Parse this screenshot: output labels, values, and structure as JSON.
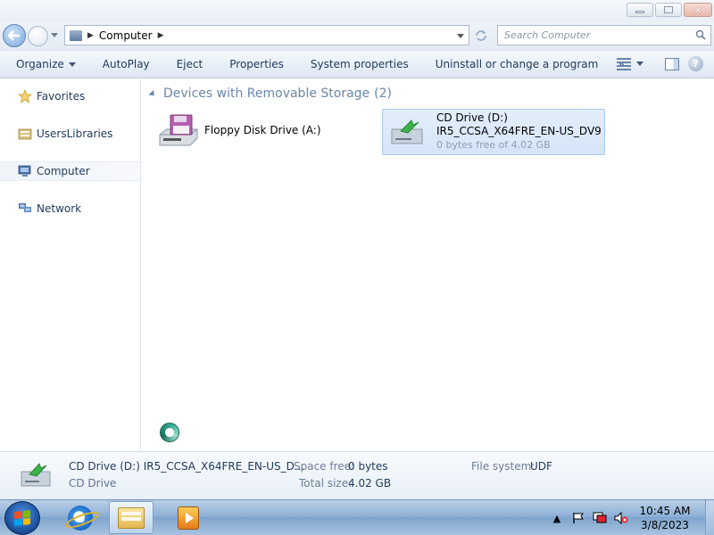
{
  "window": {
    "min_icon": "minimize-icon",
    "max_icon": "maximize-icon",
    "close_icon": "close-icon"
  },
  "address": {
    "crumbs": [
      "Computer"
    ],
    "search_placeholder": "Search Computer"
  },
  "toolbar": {
    "organize": "Organize",
    "autoplay": "AutoPlay",
    "eject": "Eject",
    "properties": "Properties",
    "system_properties": "System properties",
    "uninstall": "Uninstall or change a program",
    "more": "»"
  },
  "nav": {
    "items": [
      {
        "label": "Favorites",
        "icon": "star-icon"
      },
      {
        "label": "UsersLibraries",
        "icon": "libraries-icon"
      },
      {
        "label": "Computer",
        "icon": "computer-icon"
      },
      {
        "label": "Network",
        "icon": "network-icon"
      }
    ],
    "selected": "Computer"
  },
  "content": {
    "group_title": "Devices with Removable Storage",
    "group_count": "(2)",
    "devices": [
      {
        "name": "Floppy Disk Drive (A:)",
        "icon": "floppy-drive-icon"
      },
      {
        "name": "CD Drive (D:)",
        "label": "IR5_CCSA_X64FRE_EN-US_DV9",
        "free": "0 bytes free of 4.02 GB",
        "icon": "cd-drive-icon",
        "selected": true
      }
    ]
  },
  "details": {
    "name": "CD Drive (D:) IR5_CCSA_X64FRE_EN-US_D...",
    "type": "CD Drive",
    "space_free_label": "Space free:",
    "space_free_value": "0 bytes",
    "total_size_label": "Total size:",
    "total_size_value": "4.02 GB",
    "file_system_label": "File system:",
    "file_system_value": "UDF"
  },
  "taskbar": {
    "apps": [
      "internet-explorer-icon",
      "windows-explorer-icon",
      "media-player-icon"
    ],
    "active_app": "windows-explorer-icon",
    "clock_time": "10:45 AM",
    "clock_date": "3/8/2023",
    "tray_icons": [
      "show-hidden-icons",
      "action-center-flag-icon",
      "network-icon",
      "volume-muted-icon"
    ]
  },
  "colors": {
    "accent": "#1e395b",
    "selection": "#d5e5f8",
    "group_header": "#6a86aa"
  }
}
